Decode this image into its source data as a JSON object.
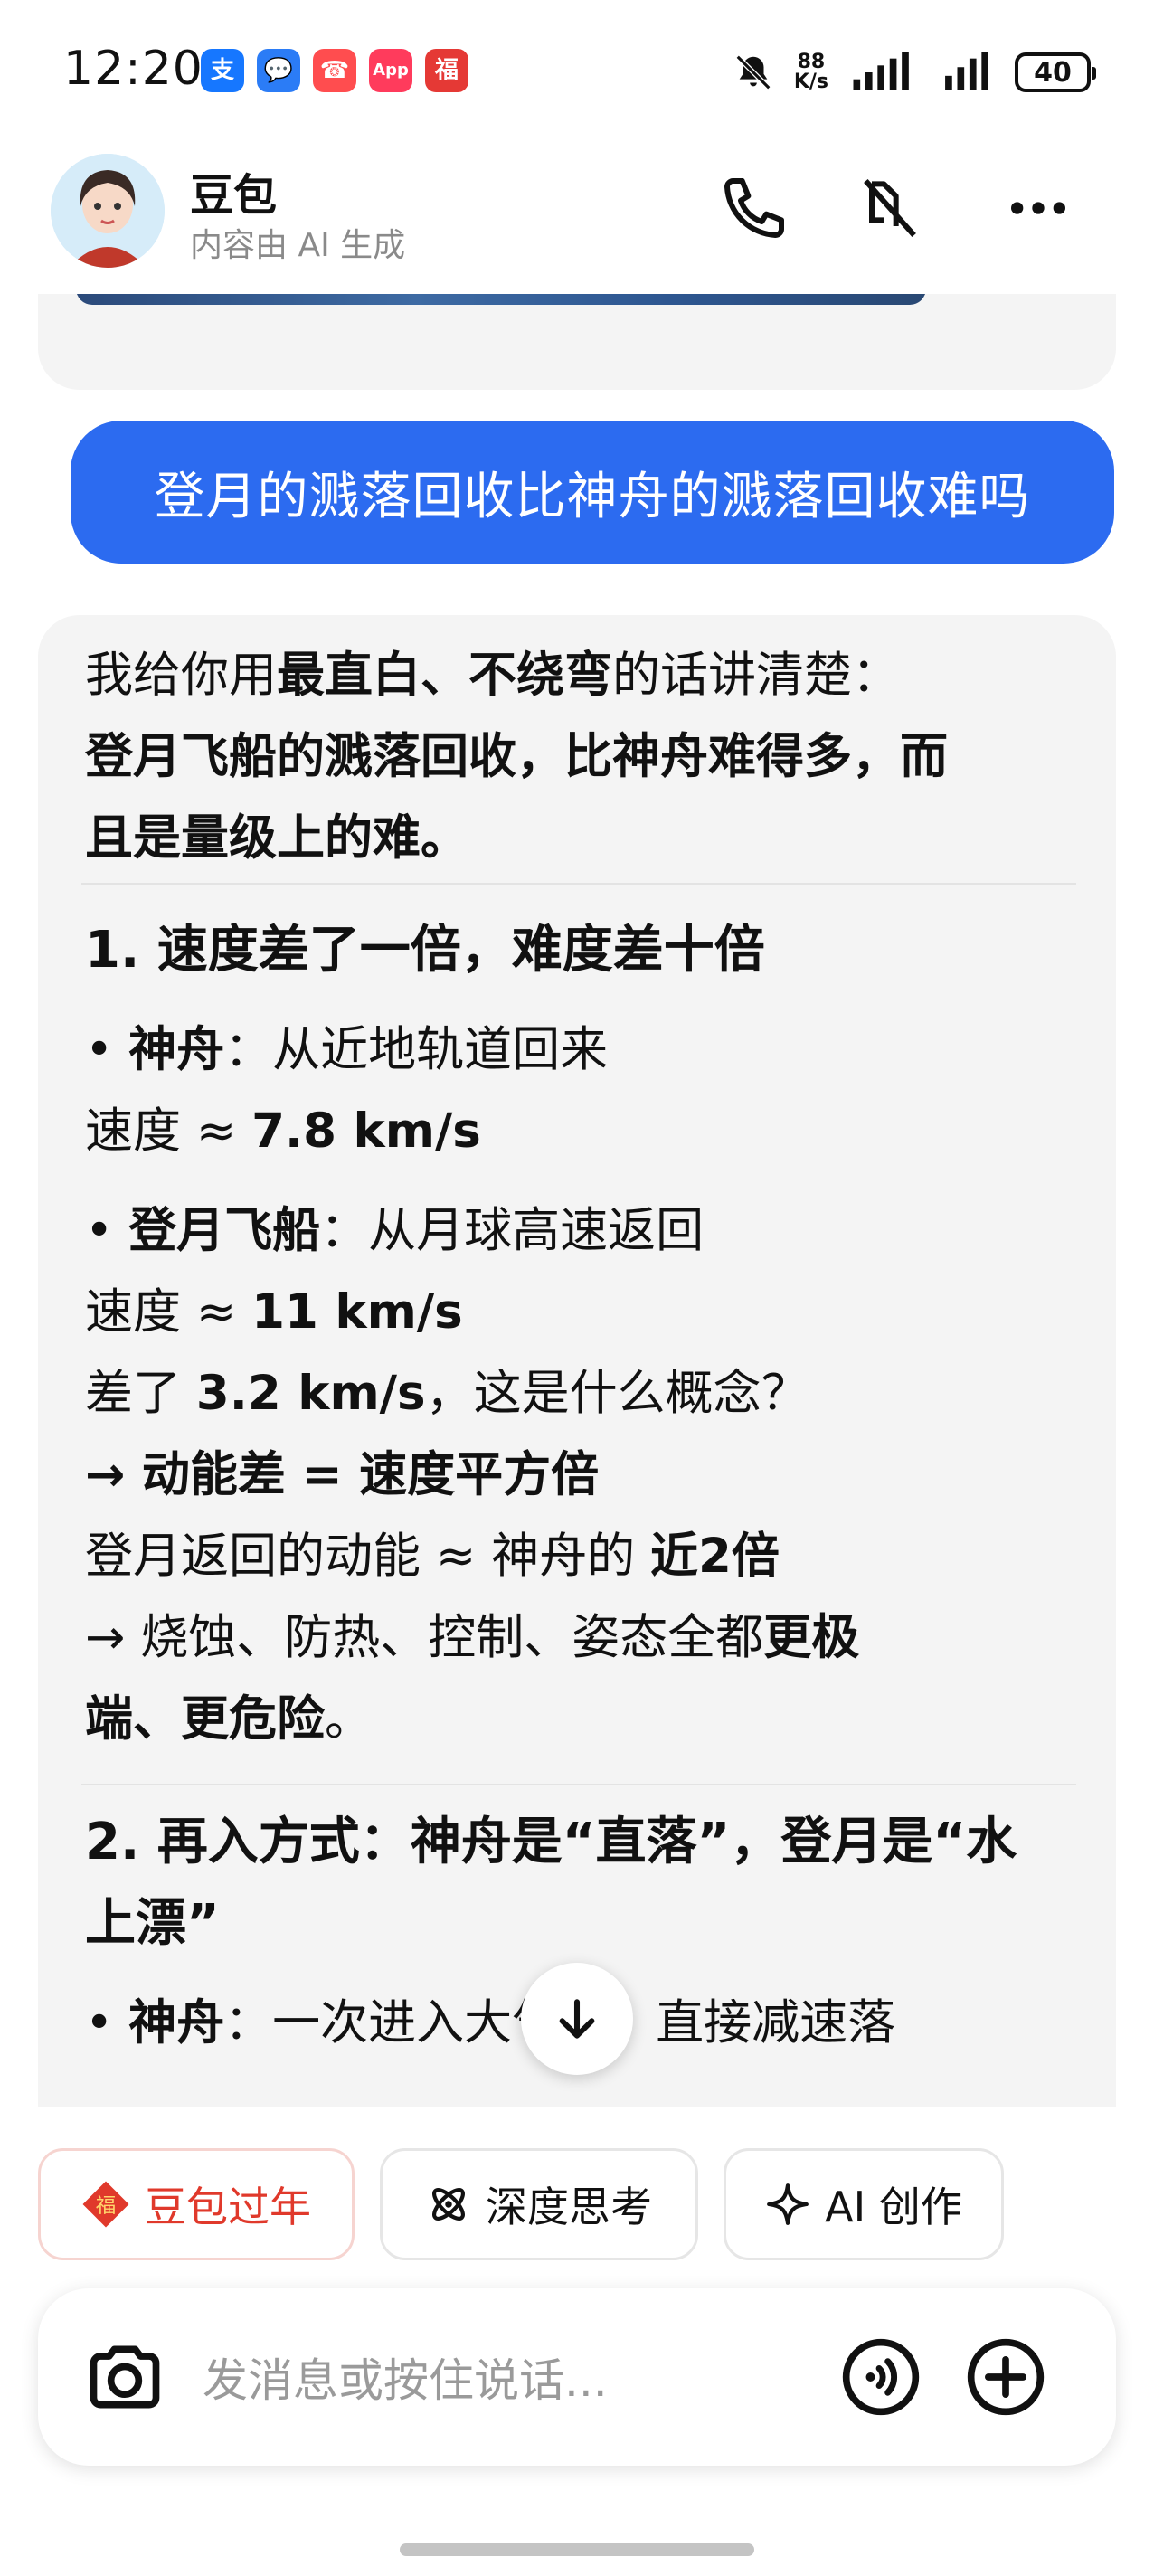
{
  "status_bar": {
    "time": "12:20",
    "apps": [
      {
        "name": "alipay-icon",
        "glyph": "支",
        "color": "#1677ff"
      },
      {
        "name": "messages-icon",
        "glyph": "💬",
        "color": "#2b7cf6"
      },
      {
        "name": "phone-missed-icon",
        "glyph": "☎",
        "color": "#ff4d4f"
      },
      {
        "name": "app-gallery-icon",
        "glyph": "App",
        "color": "#ff3b5c"
      },
      {
        "name": "red-packet-icon",
        "glyph": "福",
        "color": "#e53935"
      }
    ],
    "net_speed_value": "88",
    "net_speed_unit": "K/s",
    "battery": "40"
  },
  "header": {
    "name": "豆包",
    "subtitle": "内容由 AI 生成"
  },
  "user_message": "登月的溅落回收比神舟的溅落回收难吗",
  "reply": {
    "intro_a": "我给你用",
    "intro_b": "最直白、不绕弯",
    "intro_c": "的话讲清楚：",
    "summary_1": "登月飞船的溅落回收，比神舟难得多，而",
    "summary_2": "且是量级上的难。",
    "section1_title": "1. 速度差了一倍，难度差十倍",
    "shenzhou_label": "神舟",
    "shenzhou_desc": "：从近地轨道回来",
    "speed_label": "速度 ≈ ",
    "shenzhou_speed": "7.8 km/s",
    "lunar_label": "登月飞船",
    "lunar_desc": "：从月球高速返回",
    "lunar_speed": "11 km/s",
    "diff_a": "差了 ",
    "diff_b": "3.2 km/s",
    "diff_c": "，这是什么概念？",
    "energy_line": "→ 动能差 = 速度平方倍",
    "energy_a": "登月返回的动能 ≈ 神舟的 ",
    "energy_b": "近2倍",
    "extreme_a": "→ 烧蚀、防热、控制、姿态全都",
    "extreme_b": "更极",
    "extreme_c": "端、更危险",
    "extreme_d": "。",
    "section2_title_1": "2. 再入方式：神舟是“直落”，登月是“水",
    "section2_title_2": "上漂”",
    "last_label": "神舟",
    "last_a": "：一次进入大",
    "last_b": "气层，直接减速落"
  },
  "chips": {
    "new_year": "豆包过年",
    "deep_think": "深度思考",
    "ai_create": "AI 创作"
  },
  "input": {
    "placeholder": "发消息或按住说话..."
  },
  "colors": {
    "accent": "#2c6bf0",
    "bubble_gray": "#f4f4f4",
    "chip_red": "#e0392b"
  }
}
